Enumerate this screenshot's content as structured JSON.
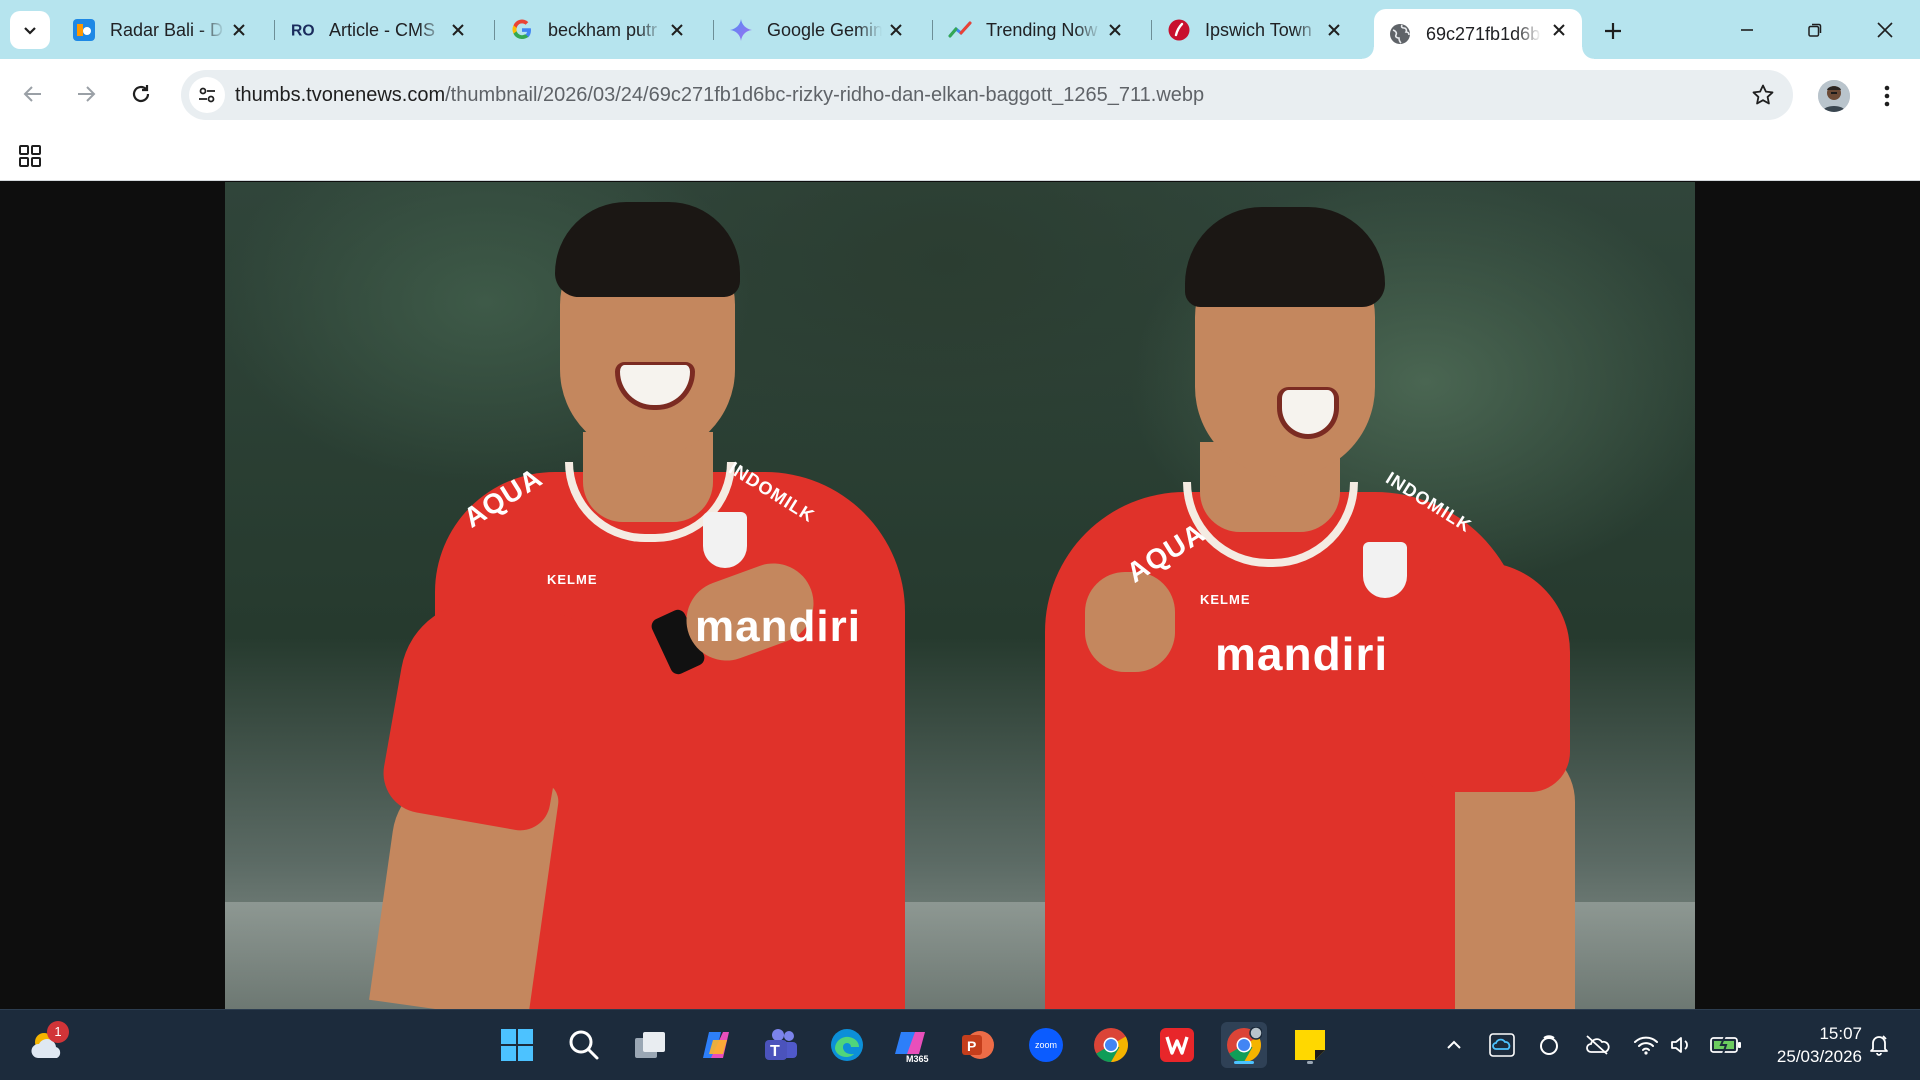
{
  "browser": {
    "tabs": [
      {
        "label": "Radar Bali - D",
        "icon": "radar-bali-favicon",
        "active": false
      },
      {
        "label": "Article - CMS",
        "icon": "ro-cms-favicon",
        "active": false
      },
      {
        "label": "beckham putr",
        "icon": "google-favicon",
        "active": false
      },
      {
        "label": "Google Gemin",
        "icon": "gemini-favicon",
        "active": false
      },
      {
        "label": "Trending Now",
        "icon": "trends-favicon",
        "active": false
      },
      {
        "label": "Ipswich Town",
        "icon": "ipswich-favicon",
        "active": false
      },
      {
        "label": "69c271fb1d6b",
        "icon": "globe-favicon",
        "active": true
      }
    ],
    "address": {
      "host": "thumbs.tvonenews.com",
      "path": "/thumbnail/2026/03/24/69c271fb1d6bc-rizky-ridho-dan-elkan-baggott_1265_711.webp"
    }
  },
  "image": {
    "left_player": {
      "sponsor_chest": "mandiri",
      "sponsor_shoulder": "AQUA",
      "sponsor_right": "INDOMILK",
      "brand": "KELME"
    },
    "right_player": {
      "sponsor_chest": "mandiri",
      "sponsor_shoulder": "AQUA",
      "sponsor_right": "INDOMILK",
      "brand": "KELME"
    }
  },
  "taskbar": {
    "weather_badge": "1",
    "apps": [
      "start-icon",
      "search-icon",
      "task-view-icon",
      "copilot-icon",
      "teams-icon",
      "edge-icon",
      "m365-icon",
      "powerpoint-icon",
      "zoom-icon",
      "chrome-icon",
      "wps-icon",
      "chrome-profile-icon",
      "sticky-notes-icon"
    ],
    "time": "15:07",
    "date": "25/03/2026"
  },
  "colors": {
    "tabstrip": "#b6e4ee",
    "jersey": "#e0322a",
    "taskbar": "#1c2b3c",
    "accent": "#4cc2ff"
  }
}
